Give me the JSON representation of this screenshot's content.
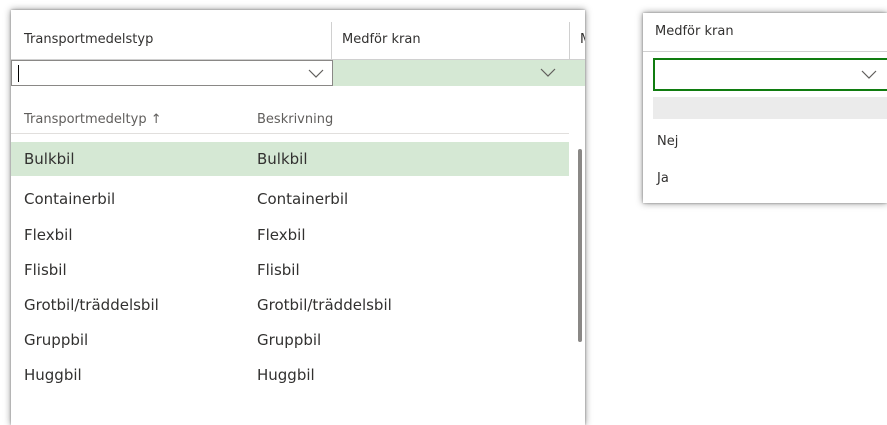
{
  "grid": {
    "columns": [
      "Transportmedelstyp",
      "Medför kran",
      "M"
    ]
  },
  "dropdown": {
    "columns": [
      "Transportmedeltyp ↑",
      "Beskrivning"
    ],
    "rows": [
      {
        "type": "Bulkbil",
        "desc": "Bulkbil"
      },
      {
        "type": "Containerbil",
        "desc": "Containerbil"
      },
      {
        "type": "Flexbil",
        "desc": "Flexbil"
      },
      {
        "type": "Flisbil",
        "desc": "Flisbil"
      },
      {
        "type": "Grotbil/träddelsbil",
        "desc": "Grotbil/träddelsbil"
      },
      {
        "type": "Gruppbil",
        "desc": "Gruppbil"
      },
      {
        "type": "Huggbil",
        "desc": "Huggbil"
      }
    ],
    "selected_index": 0
  },
  "kran_panel": {
    "header": "Medför kran",
    "options": [
      "Nej",
      "Ja"
    ]
  },
  "colors": {
    "selected": "#d5e8d4",
    "green_border": "#107c10"
  },
  "icons": [
    "chevron-down-icon",
    "sort-ascending-icon"
  ]
}
